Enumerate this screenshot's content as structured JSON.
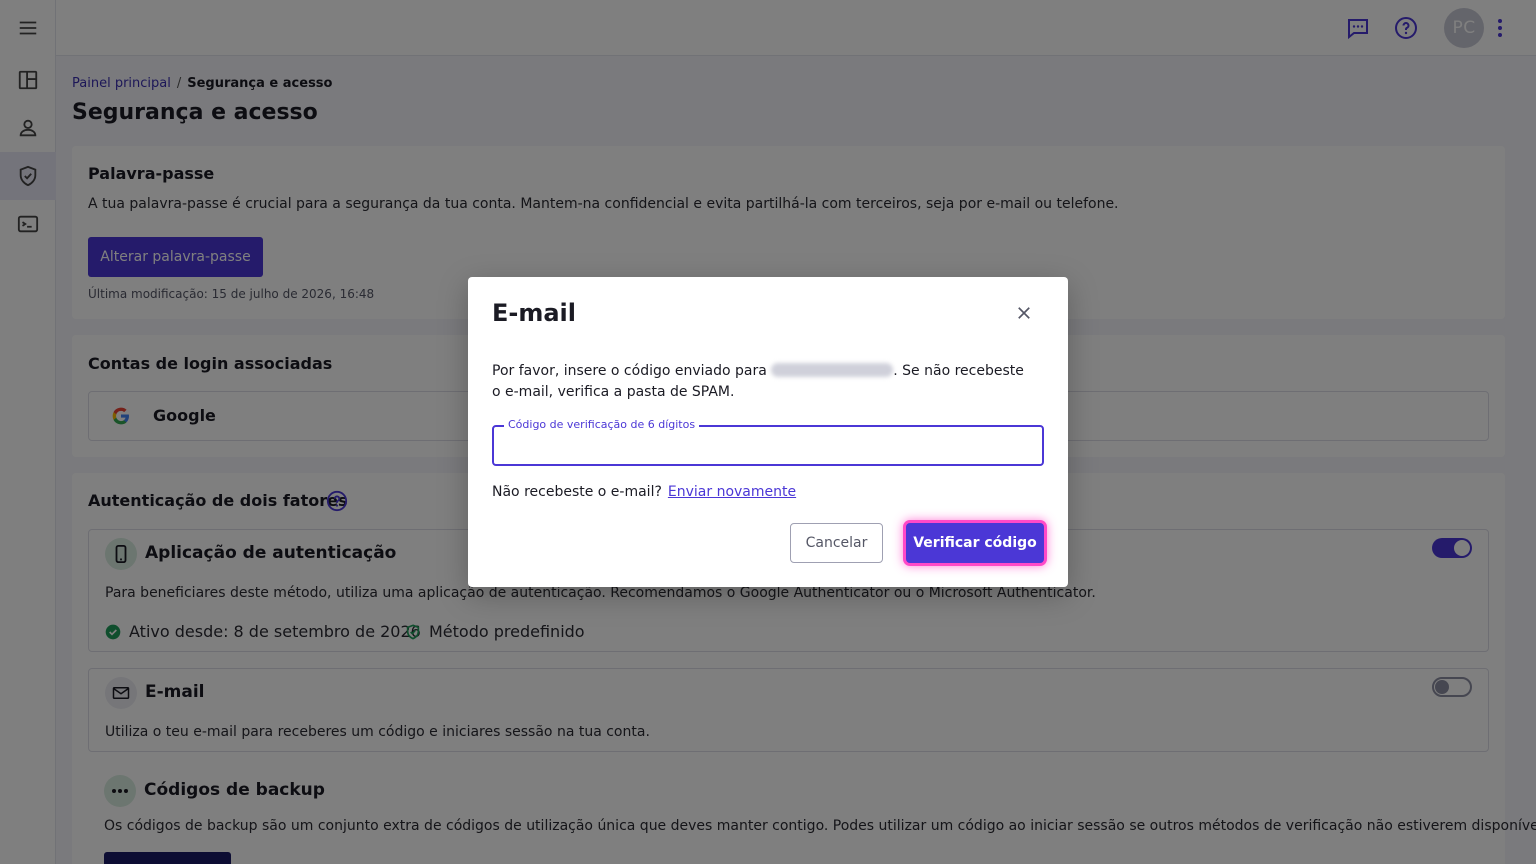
{
  "topbar": {
    "avatar_initials": "PC",
    "icons": [
      "feedback-icon",
      "help-icon",
      "more-vert-icon"
    ]
  },
  "sidebar": {
    "items": [
      {
        "icon": "menu-icon"
      },
      {
        "icon": "dashboard-icon"
      },
      {
        "icon": "person-icon"
      },
      {
        "icon": "shield-icon",
        "active": true
      },
      {
        "icon": "terminal-icon"
      }
    ]
  },
  "breadcrumb": {
    "home": "Painel principal",
    "separator": "/",
    "current": "Segurança e acesso"
  },
  "page": {
    "title": "Segurança e acesso"
  },
  "password_card": {
    "title": "Palavra-passe",
    "description": "A tua palavra-passe é crucial para a segurança da tua conta. Mantem-na confidencial e evita partilhá-la com terceiros, seja por e-mail ou telefone.",
    "button": "Alterar palavra-passe",
    "last_modified": "Última modificação: 15 de julho de 2026, 16:48"
  },
  "linked_accounts": {
    "title": "Contas de login associadas",
    "provider": "Google"
  },
  "two_factor": {
    "title": "Autenticação de dois fatores",
    "authenticator": {
      "title": "Aplicação de autenticação",
      "description": "Para beneficiares deste método, utiliza uma aplicação de autenticação. Recomendamos o Google Authenticator ou o Microsoft Authenticator.",
      "active_since": "Ativo desde: 8 de setembro de 2026",
      "default_label": "Método predefinido",
      "enabled": true
    },
    "email": {
      "title": "E-mail",
      "description": "Utiliza o teu e-mail para receberes um código e iniciares sessão na tua conta.",
      "enabled": false
    },
    "backup": {
      "title": "Códigos de backup",
      "description": "Os códigos de backup são um conjunto extra de códigos de utilização única que deves manter contigo. Podes utilizar um código ao iniciar sessão se outros métodos de verificação não estiverem disponíveis."
    }
  },
  "modal": {
    "title": "E-mail",
    "body_before": "Por favor, insere o código enviado para",
    "body_after": ". Se não recebeste o e-mail, verifica a pasta de SPAM.",
    "field_label": "Código de verificação de 6 dígitos",
    "field_value": "",
    "resend_prompt": "Não recebeste o e-mail?",
    "resend_link": "Enviar novamente",
    "cancel": "Cancelar",
    "verify": "Verificar código"
  },
  "colors": {
    "accent": "#4b37d6",
    "focus_ring": "#ff49c8",
    "success": "#1f9d5a"
  }
}
